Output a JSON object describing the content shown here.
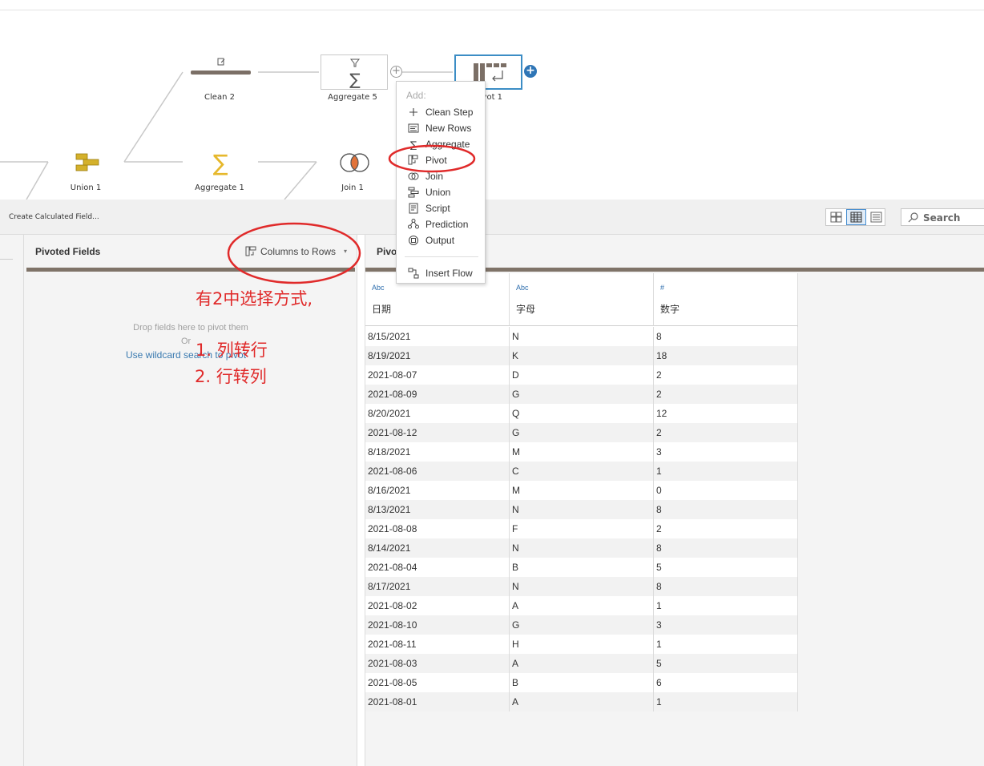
{
  "flow": {
    "nodes": [
      {
        "label": "Clean 2"
      },
      {
        "label": "Aggregate 5"
      },
      {
        "label": "Pivot 1"
      },
      {
        "label": "Union 1"
      },
      {
        "label": "Aggregate 1"
      },
      {
        "label": "Join 1"
      }
    ]
  },
  "add_menu": {
    "header": "Add:",
    "items": [
      {
        "label": "Clean Step",
        "icon": "plus-icon"
      },
      {
        "label": "New Rows",
        "icon": "new-rows-icon"
      },
      {
        "label": "Aggregate",
        "icon": "sigma-icon"
      },
      {
        "label": "Pivot",
        "icon": "pivot-icon"
      },
      {
        "label": "Join",
        "icon": "join-icon"
      },
      {
        "label": "Union",
        "icon": "union-icon"
      },
      {
        "label": "Script",
        "icon": "script-icon"
      },
      {
        "label": "Prediction",
        "icon": "prediction-icon"
      },
      {
        "label": "Output",
        "icon": "output-icon"
      },
      {
        "label": "Insert Flow",
        "icon": "insert-flow-icon"
      }
    ]
  },
  "toolbar": {
    "create_calc": "Create Calculated Field...",
    "search_label": "Search"
  },
  "pivot_panel": {
    "title": "Pivoted Fields",
    "mode_label": "Columns to Rows",
    "drop_hint": "Drop fields here to pivot them",
    "or_text": "Or",
    "wildcard_link": "Use wildcard search to pivot"
  },
  "annotation": {
    "line1": "有2中选择方式,",
    "line2": "1. 列转行",
    "line3": "2. 行转列",
    "color": "#e02a2a"
  },
  "results": {
    "title": "Pivo",
    "columns": [
      {
        "type": "Abc",
        "name": "日期"
      },
      {
        "type": "Abc",
        "name": "字母"
      },
      {
        "type": "#",
        "name": "数字"
      }
    ],
    "rows": [
      [
        "8/15/2021",
        "N",
        "8"
      ],
      [
        "8/19/2021",
        "K",
        "18"
      ],
      [
        "2021-08-07",
        "D",
        "2"
      ],
      [
        "2021-08-09",
        "G",
        "2"
      ],
      [
        "8/20/2021",
        "Q",
        "12"
      ],
      [
        "2021-08-12",
        "G",
        "2"
      ],
      [
        "8/18/2021",
        "M",
        "3"
      ],
      [
        "2021-08-06",
        "C",
        "1"
      ],
      [
        "8/16/2021",
        "M",
        "0"
      ],
      [
        "8/13/2021",
        "N",
        "8"
      ],
      [
        "2021-08-08",
        "F",
        "2"
      ],
      [
        "8/14/2021",
        "N",
        "8"
      ],
      [
        "2021-08-04",
        "B",
        "5"
      ],
      [
        "8/17/2021",
        "N",
        "8"
      ],
      [
        "2021-08-02",
        "A",
        "1"
      ],
      [
        "2021-08-10",
        "G",
        "3"
      ],
      [
        "2021-08-11",
        "H",
        "1"
      ],
      [
        "2021-08-03",
        "A",
        "5"
      ],
      [
        "2021-08-05",
        "B",
        "6"
      ],
      [
        "2021-08-01",
        "A",
        "1"
      ]
    ]
  }
}
